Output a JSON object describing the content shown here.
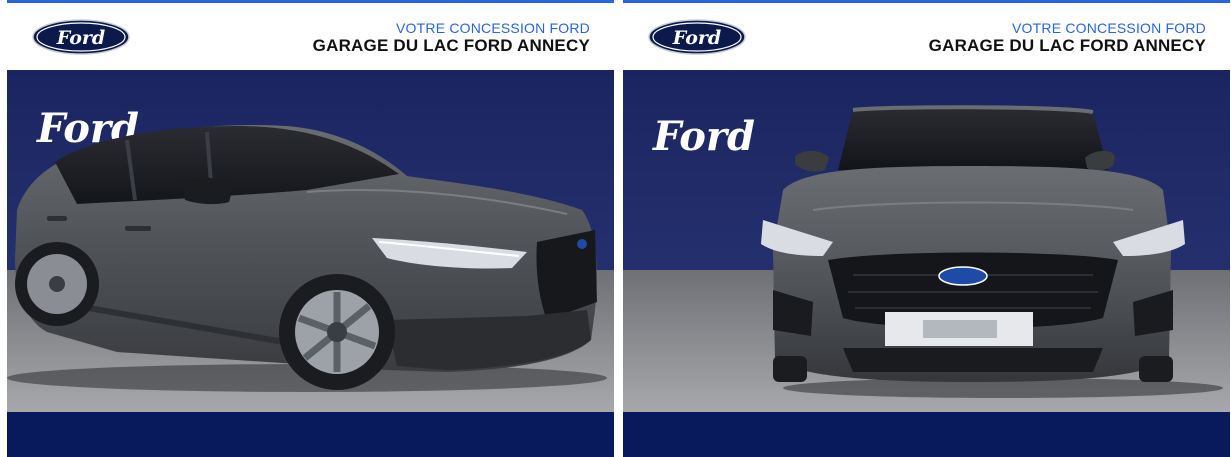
{
  "colors": {
    "ford_blue": "#0b1a4a",
    "backdrop_blue": "#1e2a68",
    "footer_blue": "#081a5c",
    "accent_blue": "#2a64e0",
    "car_grey": "#55585c"
  },
  "panels": [
    {
      "view": "three-quarter-front",
      "dealer_tagline": "VOTRE CONCESSION FORD",
      "dealer_name": "GARAGE DU LAC FORD ANNECY",
      "logo_text": "Ford",
      "wall_script": "Ford"
    },
    {
      "view": "front",
      "dealer_tagline": "VOTRE CONCESSION FORD",
      "dealer_name": "GARAGE DU LAC FORD ANNECY",
      "logo_text": "Ford",
      "wall_script": "Ford"
    }
  ]
}
